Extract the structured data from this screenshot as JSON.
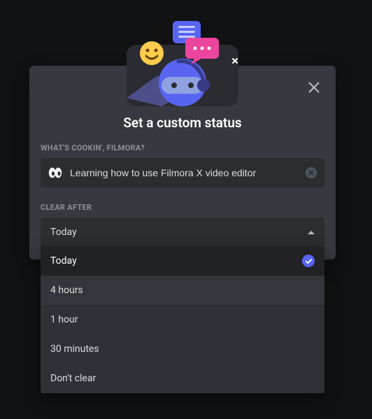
{
  "modal": {
    "title": "Set a custom status",
    "prompt_label": "WHAT'S COOKIN', FILMORA?",
    "status_value": "Learning how to use Filmora X video editor",
    "status_placeholder": "",
    "emoji_name": "eyes-emoji",
    "clear_after_label": "CLEAR AFTER",
    "clear_after_selected": "Today"
  },
  "clear_options": [
    {
      "label": "Today",
      "selected": true
    },
    {
      "label": "4 hours",
      "selected": false
    },
    {
      "label": "1 hour",
      "selected": false
    },
    {
      "label": "30 minutes",
      "selected": false
    },
    {
      "label": "Don't clear",
      "selected": false
    }
  ],
  "colors": {
    "accent": "#5865f2",
    "modal_bg": "#36393f",
    "page_bg": "#111214"
  }
}
